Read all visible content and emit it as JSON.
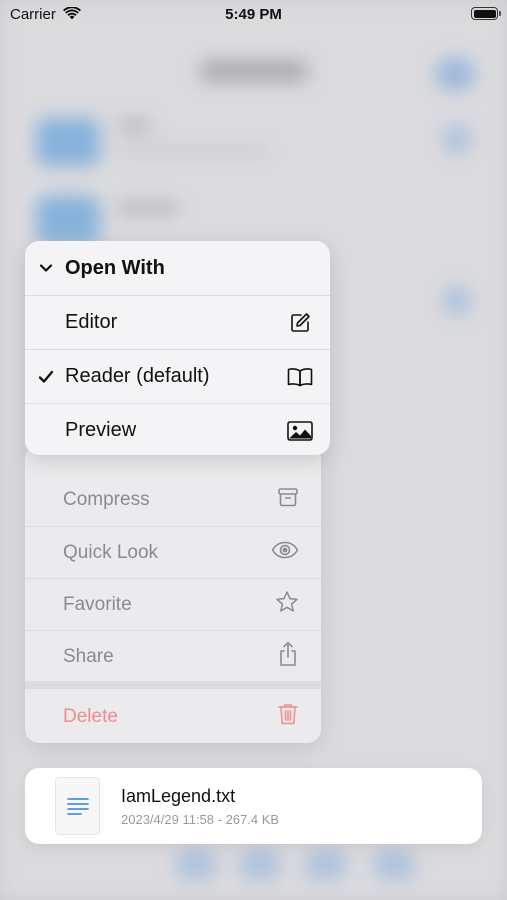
{
  "status_bar": {
    "carrier": "Carrier",
    "time": "5:49 PM"
  },
  "open_with": {
    "header": "Open With",
    "items": [
      {
        "label": "Editor",
        "icon": "compose-icon",
        "selected": false
      },
      {
        "label": "Reader (default)",
        "icon": "book-icon",
        "selected": true
      },
      {
        "label": "Preview",
        "icon": "photo-icon",
        "selected": false
      }
    ]
  },
  "menu": {
    "items": [
      {
        "label": "Compress",
        "icon": "archive-icon"
      },
      {
        "label": "Quick Look",
        "icon": "eye-icon"
      },
      {
        "label": "Favorite",
        "icon": "star-icon"
      },
      {
        "label": "Share",
        "icon": "share-icon"
      }
    ],
    "delete_label": "Delete"
  },
  "file": {
    "name": "IamLegend.txt",
    "meta": "2023/4/29 11:58 - 267.4 KB",
    "icon": "text-document-icon"
  },
  "colors": {
    "accent_blue": "#2f7fe0",
    "destructive": "#f08c8c",
    "dimmed_text": "#8b8b8f"
  }
}
